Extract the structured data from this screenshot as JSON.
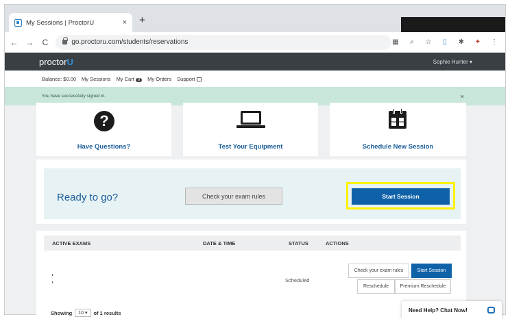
{
  "browser": {
    "tab_title": "My Sessions | ProctorU",
    "tab_close": "×",
    "new_tab": "+",
    "url": "go.proctoru.com/students/reservations",
    "nav": {
      "back": "←",
      "forward": "→",
      "reload": "C"
    }
  },
  "header": {
    "logo_text": "proctor",
    "logo_accent": "U",
    "user_menu": "Sophie Hunter ▾"
  },
  "subnav": {
    "balance": "Balance: $0.00",
    "sessions": "My Sessions",
    "cart": "My Cart",
    "cart_count": "0",
    "orders": "My Orders",
    "support": "Support"
  },
  "alert": {
    "message": "You have successfully signed in.",
    "close": "×"
  },
  "cards": {
    "questions": "Have Questions?",
    "equipment": "Test Your Equipment",
    "schedule": "Schedule New Session"
  },
  "ready": {
    "heading": "Ready to go?",
    "check_rules": "Check your exam rules",
    "start": "Start Session"
  },
  "table": {
    "headers": [
      "ACTIVE EXAMS",
      "DATE & TIME",
      "STATUS",
      "ACTIONS"
    ],
    "row": {
      "status": "Scheduled",
      "check_rules": "Check your exam rules",
      "start": "Start Session",
      "reschedule": "Reschedule",
      "premium": "Premium Reschedule"
    }
  },
  "pagination": {
    "showing": "Showing",
    "per_page": "10",
    "of_results": "of 1 results"
  },
  "chat": {
    "label": "Need Help? Chat Now!"
  },
  "colors": {
    "brand_blue": "#0f62a8",
    "highlight": "#fff200",
    "alert_bg": "#c8e6d9",
    "nav_bg": "#3a3f44"
  }
}
